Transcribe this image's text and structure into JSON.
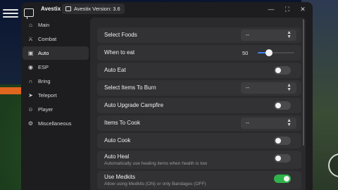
{
  "app": {
    "title": "Avestix",
    "version": "Avestix Version: 3.6",
    "window_controls": [
      "minimize-icon",
      "maximize-icon",
      "close-icon"
    ]
  },
  "sidebar": {
    "items": [
      {
        "label": "Main",
        "icon": "home-icon",
        "active": false
      },
      {
        "label": "Combat",
        "icon": "sword-icon",
        "active": false
      },
      {
        "label": "Auto",
        "icon": "auto-icon",
        "active": true
      },
      {
        "label": "ESP",
        "icon": "eye-icon",
        "active": false
      },
      {
        "label": "Bring",
        "icon": "magnet-icon",
        "active": false
      },
      {
        "label": "Teleport",
        "icon": "send-icon",
        "active": false
      },
      {
        "label": "Player",
        "icon": "user-icon",
        "active": false
      },
      {
        "label": "Miscellaneous",
        "icon": "gear-icon",
        "active": false
      }
    ]
  },
  "settings": {
    "select_foods": {
      "label": "Select Foods",
      "value": "--"
    },
    "when_to_eat": {
      "label": "When to eat",
      "value": "50",
      "level": 0.3
    },
    "auto_eat": {
      "label": "Auto Eat",
      "on": false
    },
    "select_items_to_burn": {
      "label": "Select Items To Burn",
      "value": "--"
    },
    "auto_upgrade_campfire": {
      "label": "Auto Upgrade Campfire",
      "on": false
    },
    "items_to_cook": {
      "label": "Items To Cook",
      "value": "--"
    },
    "auto_cook": {
      "label": "Auto Cook",
      "on": false
    },
    "auto_heal": {
      "label": "Auto Heal",
      "desc": "Automatically use healing items when health is low",
      "on": false
    },
    "use_medkits": {
      "label": "Use Medkits",
      "desc": "Allow using Medkits (ON) or only Bandages (OFF)",
      "on": true
    }
  },
  "colors": {
    "toggle_on": "#2fb34a",
    "slider_accent": "#3b82f6"
  }
}
